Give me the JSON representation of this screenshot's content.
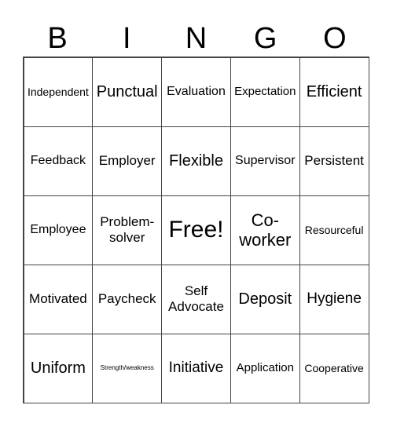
{
  "header": [
    "B",
    "I",
    "N",
    "G",
    "O"
  ],
  "cells": [
    [
      "Independent",
      "Punctual",
      "Evaluation",
      "Expectation",
      "Efficient"
    ],
    [
      "Feedback",
      "Employer",
      "Flexible",
      "Supervisor",
      "Persistent"
    ],
    [
      "Employee",
      "Problem-solver",
      "Free!",
      "Co-worker",
      "Resourceful"
    ],
    [
      "Motivated",
      "Paycheck",
      "Self Advocate",
      "Deposit",
      "Hygiene"
    ],
    [
      "Uniform",
      "Strength/weakness",
      "Initiative",
      "Application",
      "Cooperative"
    ]
  ]
}
